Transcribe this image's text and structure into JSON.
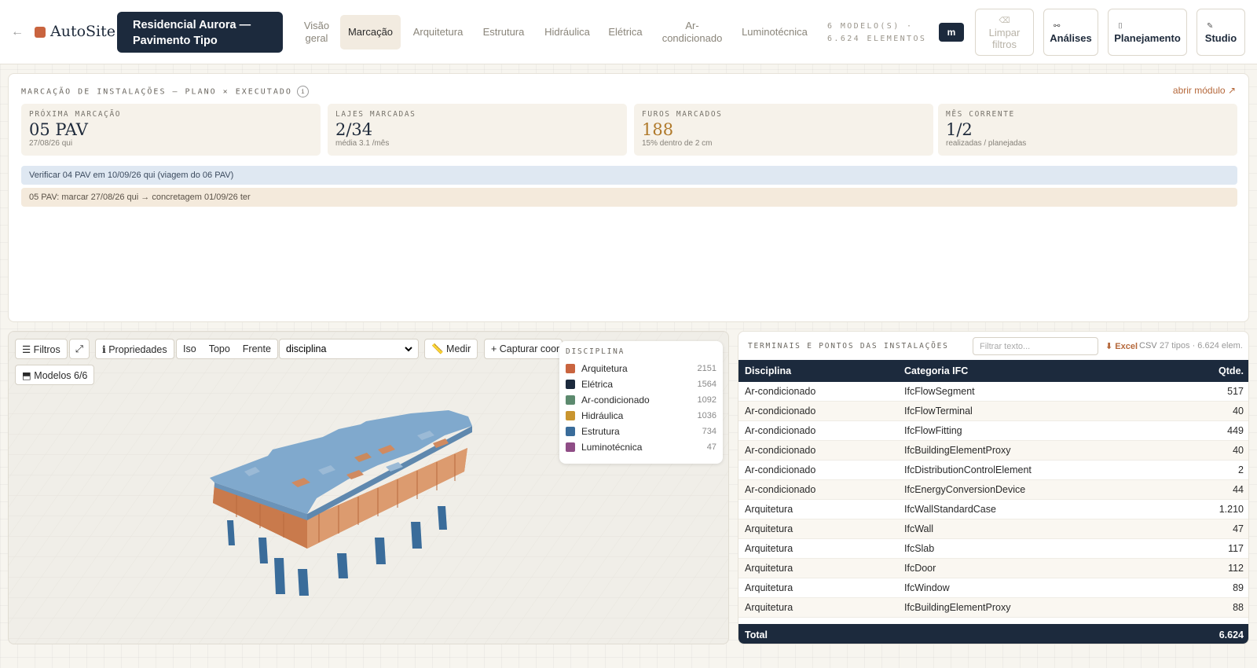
{
  "header": {
    "back_icon": "arrow-left-icon",
    "app_name": "AutoSite",
    "project_line1": "Residencial Aurora —",
    "project_line2": "Pavimento Tipo",
    "tabs": [
      {
        "l1": "Visão",
        "l2": "geral"
      },
      {
        "l1": "Marcação",
        "l2": ""
      },
      {
        "l1": "Arquitetura",
        "l2": ""
      },
      {
        "l1": "Estrutura",
        "l2": ""
      },
      {
        "l1": "Hidráulica",
        "l2": ""
      },
      {
        "l1": "Elétrica",
        "l2": ""
      },
      {
        "l1": "Ar-",
        "l2": "condicionado"
      },
      {
        "l1": "Luminotécnica",
        "l2": ""
      }
    ],
    "active_tab": "Marcação",
    "models_line1": "6 MODELO(S) ·",
    "models_line2": "6.624 ELEMENTOS",
    "unit_button": "m",
    "clear_icon": "⌫",
    "clear_line1": "Limpar",
    "clear_line2": "filtros",
    "analises_icon": "⚯",
    "analises": "Análises",
    "planejamento_icon": "⌷",
    "planejamento": "Planejamento",
    "studio_icon": "✎",
    "studio": "Studio"
  },
  "marcacao": {
    "title": "MARCAÇÃO DE INSTALAÇÕES — PLANO × EXECUTADO",
    "info_icon": "i",
    "open_module": "abrir módulo ↗",
    "cards": [
      {
        "label": "PRÓXIMA MARCAÇÃO",
        "value": "05 PAV",
        "sub": "27/08/26 qui"
      },
      {
        "label": "LAJES MARCADAS",
        "value": "2/34",
        "sub": "média 3.1 /mês"
      },
      {
        "label": "FUROS MARCADOS",
        "value": "188",
        "sub": "15% dentro de 2 cm"
      },
      {
        "label": "MÊS CORRENTE",
        "value": "1/2",
        "sub": "realizadas / planejadas"
      }
    ],
    "alert_blue": "Verificar 04 PAV em 10/09/26 qui (viagem do 06 PAV)",
    "alert_tan": "05 PAV: marcar 27/08/26 qui → concretagem 01/09/26 ter"
  },
  "viewer": {
    "filtros": "☰ Filtros",
    "expand_icon": "⤢",
    "propriedades": "ℹ Propriedades",
    "views": [
      "Iso",
      "Topo",
      "Frente"
    ],
    "color_by": "disciplina",
    "medir": "📏 Medir",
    "capturar": "+ Capturar coord",
    "modelos": "⬒ Modelos 6/6",
    "legend_title": "DISCIPLINA",
    "legend": [
      {
        "name": "Arquitetura",
        "count": "2151",
        "color": "#c9643f"
      },
      {
        "name": "Elétrica",
        "count": "1564",
        "color": "#1c2a3d"
      },
      {
        "name": "Ar-condicionado",
        "count": "1092",
        "color": "#5c8a6e"
      },
      {
        "name": "Hidráulica",
        "count": "1036",
        "color": "#c9952f"
      },
      {
        "name": "Estrutura",
        "count": "734",
        "color": "#3a6c9a"
      },
      {
        "name": "Luminotécnica",
        "count": "47",
        "color": "#8f4d86"
      }
    ]
  },
  "table": {
    "title": "TERMINAIS E PONTOS DAS INSTALAÇÕES",
    "filter_placeholder": "Filtrar texto...",
    "excel": "⬇ Excel",
    "csv": "CSV",
    "meta": "27 tipos · 6.624 elem.",
    "headers": [
      "Disciplina",
      "Categoria IFC",
      "Qtde."
    ],
    "rows": [
      [
        "Ar-condicionado",
        "IfcFlowSegment",
        "517"
      ],
      [
        "Ar-condicionado",
        "IfcFlowTerminal",
        "40"
      ],
      [
        "Ar-condicionado",
        "IfcFlowFitting",
        "449"
      ],
      [
        "Ar-condicionado",
        "IfcBuildingElementProxy",
        "40"
      ],
      [
        "Ar-condicionado",
        "IfcDistributionControlElement",
        "2"
      ],
      [
        "Ar-condicionado",
        "IfcEnergyConversionDevice",
        "44"
      ],
      [
        "Arquitetura",
        "IfcWallStandardCase",
        "1.210"
      ],
      [
        "Arquitetura",
        "IfcWall",
        "47"
      ],
      [
        "Arquitetura",
        "IfcSlab",
        "117"
      ],
      [
        "Arquitetura",
        "IfcDoor",
        "112"
      ],
      [
        "Arquitetura",
        "IfcWindow",
        "89"
      ],
      [
        "Arquitetura",
        "IfcBuildingElementProxy",
        "88"
      ]
    ],
    "total_label": "Total",
    "total_value": "6.624"
  }
}
